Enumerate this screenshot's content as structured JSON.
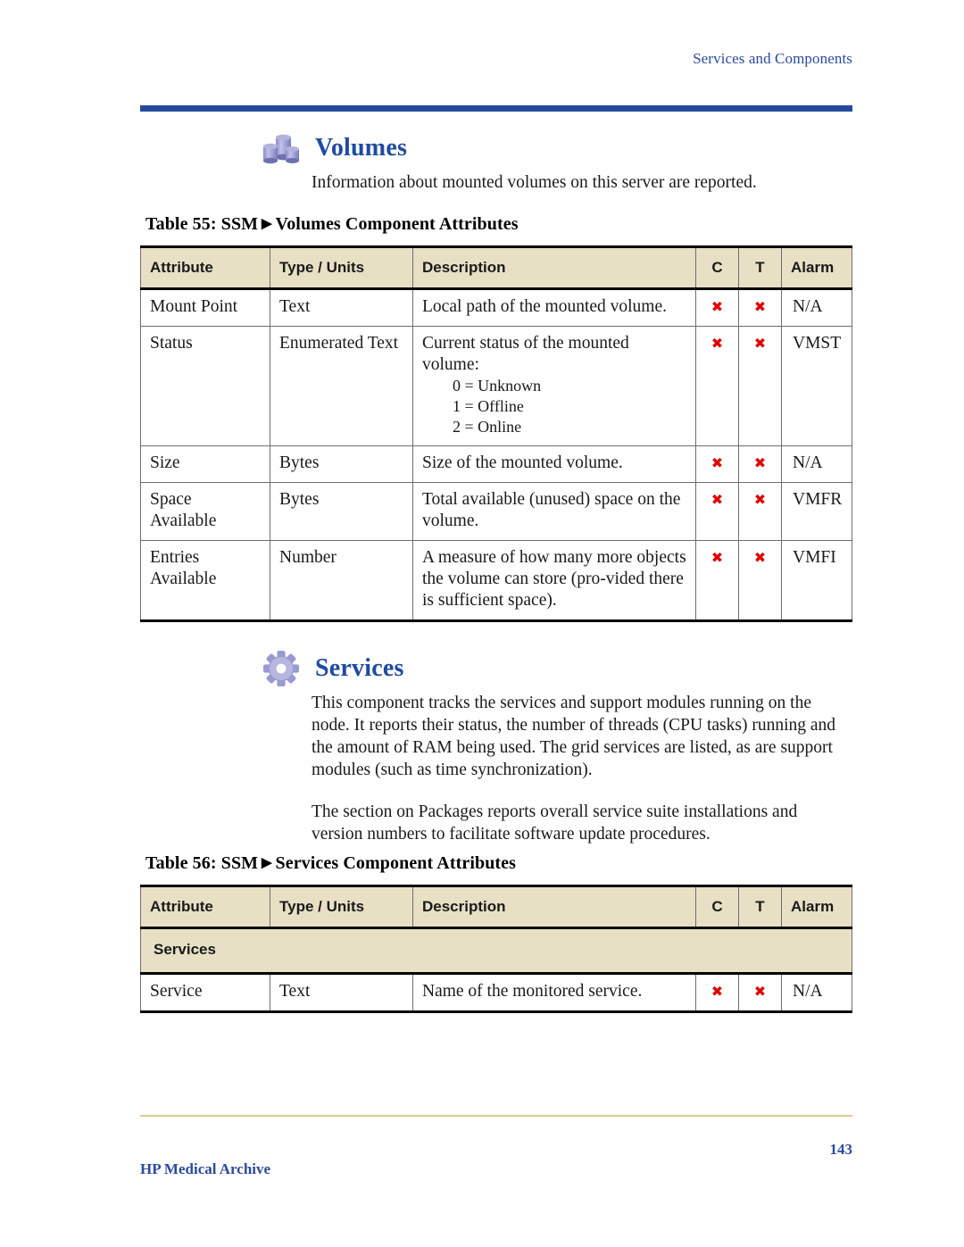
{
  "header": {
    "running_head": "Services and Components"
  },
  "sections": [
    {
      "icon": "volumes-cylinders-icon",
      "title": "Volumes",
      "paragraphs": [
        "Information about mounted volumes on this server are reported."
      ]
    },
    {
      "icon": "gear-icon",
      "title": "Services",
      "paragraphs": [
        "This component tracks the services and support modules running on the node. It reports their status, the number of threads (CPU tasks) running and the amount of RAM being used. The grid services are listed, as are support modules (such as time synchronization).",
        "The section on Packages reports overall service suite installations and version numbers to facilitate software update procedures."
      ]
    }
  ],
  "tables": [
    {
      "caption_prefix": "Table 55: SSM",
      "caption_suffix": "Volumes Component Attributes",
      "columns": [
        "Attribute",
        "Type / Units",
        "Description",
        "C",
        "T",
        "Alarm"
      ],
      "rows": [
        {
          "attribute": "Mount Point",
          "type": "Text",
          "description": "Local path of the mounted volume.",
          "c": "x",
          "t": "x",
          "alarm": "N/A"
        },
        {
          "attribute": "Status",
          "type": "Enumerated Text",
          "description": "Current status of the mounted volume:",
          "enum": [
            "0 = Unknown",
            "1 = Offline",
            "2 = Online"
          ],
          "c": "x",
          "t": "x",
          "alarm": "VMST"
        },
        {
          "attribute": "Size",
          "type": "Bytes",
          "description": "Size of the mounted volume.",
          "c": "x",
          "t": "x",
          "alarm": "N/A"
        },
        {
          "attribute": "Space Available",
          "type": "Bytes",
          "description": "Total available (unused) space on the volume.",
          "c": "x",
          "t": "x",
          "alarm": "VMFR"
        },
        {
          "attribute": "Entries Available",
          "type": "Number",
          "description": "A measure of how many more objects the volume can store (pro-vided there is sufficient space).",
          "c": "x",
          "t": "x",
          "alarm": "VMFI"
        }
      ]
    },
    {
      "caption_prefix": "Table 56: SSM",
      "caption_suffix": "Services Component Attributes",
      "columns": [
        "Attribute",
        "Type / Units",
        "Description",
        "C",
        "T",
        "Alarm"
      ],
      "subhead": "Services",
      "rows": [
        {
          "attribute": "Service",
          "type": "Text",
          "description": "Name of the monitored service.",
          "c": "x",
          "t": "x",
          "alarm": "N/A"
        }
      ]
    }
  ],
  "footer": {
    "product": "HP Medical Archive",
    "page_number": "143"
  },
  "colors": {
    "heading_blue": "#1f4ba0",
    "rule_blue": "#254a9a",
    "table_header_bg": "#e7e0c4",
    "xmark_red": "#e00000",
    "footer_rule": "#dcc98d",
    "icon_purple": "#9a9ad2"
  }
}
